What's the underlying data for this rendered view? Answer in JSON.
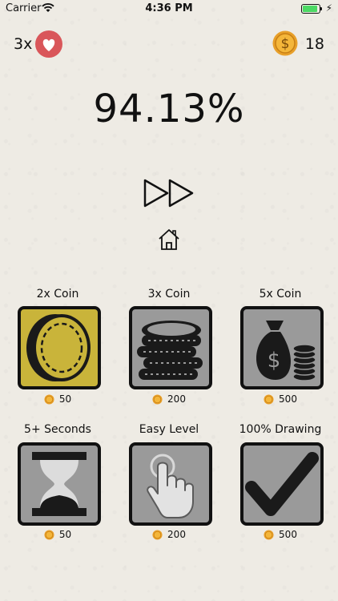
{
  "status_bar": {
    "carrier": "Carrier",
    "time": "4:36 PM"
  },
  "lives": "3x",
  "coins": "18",
  "progress_text": "94.13%",
  "colors": {
    "coin": "#e8a02a",
    "heart_badge": "#d9565a",
    "tile": "#9a9a9a",
    "tile_gold": "#c9b43a"
  },
  "shop": [
    {
      "label": "2x Coin",
      "price": "50",
      "icon": "gold-coin-icon"
    },
    {
      "label": "3x Coin",
      "price": "200",
      "icon": "coin-stack-icon"
    },
    {
      "label": "5x Coin",
      "price": "500",
      "icon": "money-bag-icon"
    },
    {
      "label": "5+ Seconds",
      "price": "50",
      "icon": "hourglass-icon"
    },
    {
      "label": "Easy Level",
      "price": "200",
      "icon": "pointing-hand-icon"
    },
    {
      "label": "100% Drawing",
      "price": "500",
      "icon": "checkmark-icon"
    }
  ]
}
